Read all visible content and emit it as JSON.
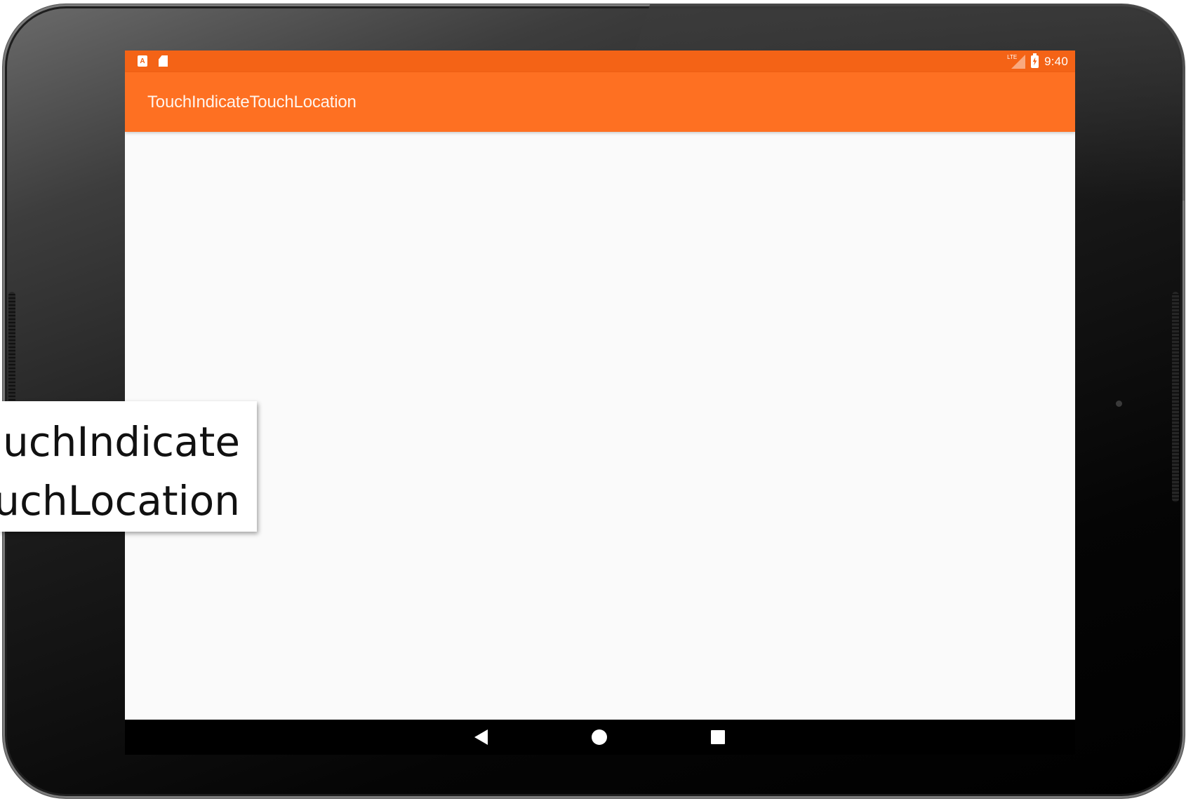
{
  "status_bar": {
    "time": "9:40",
    "notif_letter": "A",
    "network_label": "LTE",
    "icons": [
      "notification-a-icon",
      "sd-card-icon",
      "lte-signal-icon",
      "battery-charging-icon"
    ]
  },
  "app_bar": {
    "title": "TouchIndicateTouchLocation"
  },
  "nav_bar": {
    "icons": [
      "back-icon",
      "home-icon",
      "recents-icon"
    ]
  },
  "caption": {
    "line1": "uchIndicate",
    "line2": "uchLocation"
  },
  "colors": {
    "status_bar": "#f46316",
    "app_bar": "#fe7022",
    "content_bg": "#fafafa",
    "nav_bar": "#000000"
  }
}
